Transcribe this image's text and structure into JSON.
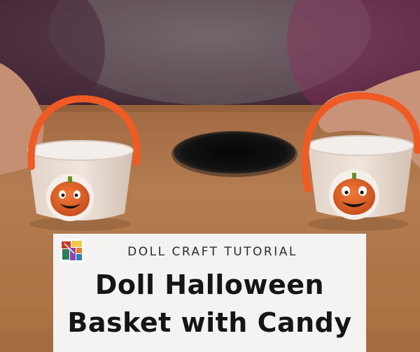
{
  "caption": {
    "subtitle": "DOLL CRAFT TUTORIAL",
    "title_line1": "Doll Halloween",
    "title_line2": "Basket with Candy"
  },
  "colors": {
    "table": "#b37a4e",
    "sweater": "#5b3340",
    "pipe_cleaner": "#f05a24",
    "pumpkin": "#e7662a",
    "hole": "#0d0d0d",
    "card_background": "#f4f3f1"
  },
  "icons": [
    "site-logo-icon",
    "pumpkin-face-icon"
  ]
}
